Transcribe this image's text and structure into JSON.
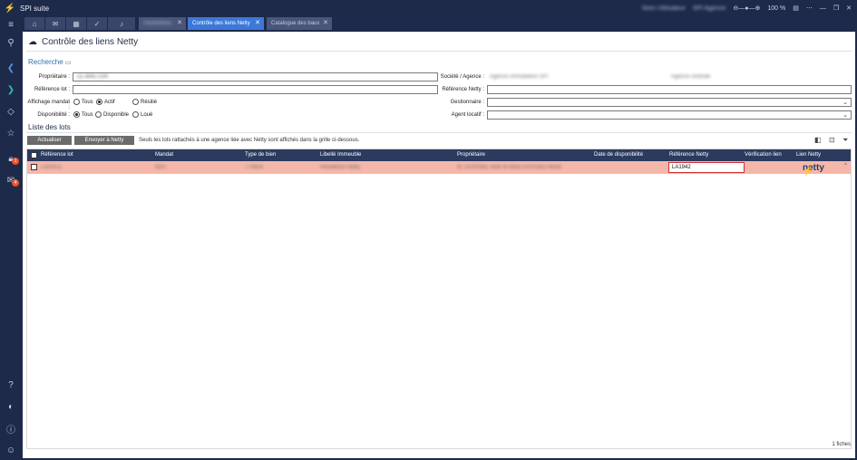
{
  "app": {
    "title": "SPI suite"
  },
  "titlebar": {
    "user_blurred": "Nom Utilisateur",
    "agency_blurred": "SPI Agence",
    "zoom": "100 %"
  },
  "tabs": {
    "icon_tabs": [
      "home-icon",
      "mail-icon",
      "calendar-icon",
      "check-icon",
      "bell-icon"
    ],
    "docs": [
      {
        "label": "Paramètres",
        "active": false
      },
      {
        "label": "Contrôle des liens Netty",
        "active": true
      },
      {
        "label": "Catalogue des baux",
        "active": false
      }
    ]
  },
  "page": {
    "title": "Contrôle des liens Netty"
  },
  "search": {
    "section_label": "Recherche",
    "proprietaire_label": "Propriétaire :",
    "proprietaire_value_blurred": "LE BRETON",
    "reference_lot_label": "Référence lot :",
    "affichage_label": "Affichage mandat :",
    "affichage_options": [
      "Tous",
      "Actif",
      "Résilié"
    ],
    "affichage_selected": "Actif",
    "disponibilite_label": "Disponibilité :",
    "disponibilite_options": [
      "Tous",
      "Disponible",
      "Loué"
    ],
    "disponibilite_selected": "Tous",
    "societe_label": "Société / Agence :",
    "societe_value_blurred": "Agence immobilière SPI",
    "societe_value2_blurred": "Agence centrale",
    "reference_netty_label": "Référence Netty :",
    "gestionnaire_label": "Gestionnaire :",
    "agent_label": "Agent locatif :"
  },
  "lots": {
    "section_label": "Liste des lots",
    "refresh_label": "Actualiser",
    "send_label": "Envoyer à Netty",
    "hint": "Seuls les lots rattachés à une agence liée avec Netty sont affichés dans la grille ci-dessous.",
    "columns": [
      "Référence lot",
      "Mandat",
      "Type de bien",
      "Libellé Immeuble",
      "Propriétaire",
      "Date de disponibilité",
      "Référence Netty",
      "Vérification lien",
      "Lien Netty"
    ],
    "row": {
      "reference_lot": "L000021",
      "mandat": "M00",
      "type_de_bien": "T Pièce",
      "libelle": "Résidence Netty",
      "proprietaire": "M. DUPOND Jean et Mme DUPOND Marie",
      "reference_netty": "LA1942",
      "lien_netty": "netty"
    },
    "footer": "1 fiches"
  },
  "colors": {
    "nav": "#1e2a4a",
    "accent": "#3c78d8",
    "header": "#2b3a5f",
    "row_highlight": "#f5b7aa",
    "netty_orange": "#e8542f"
  }
}
